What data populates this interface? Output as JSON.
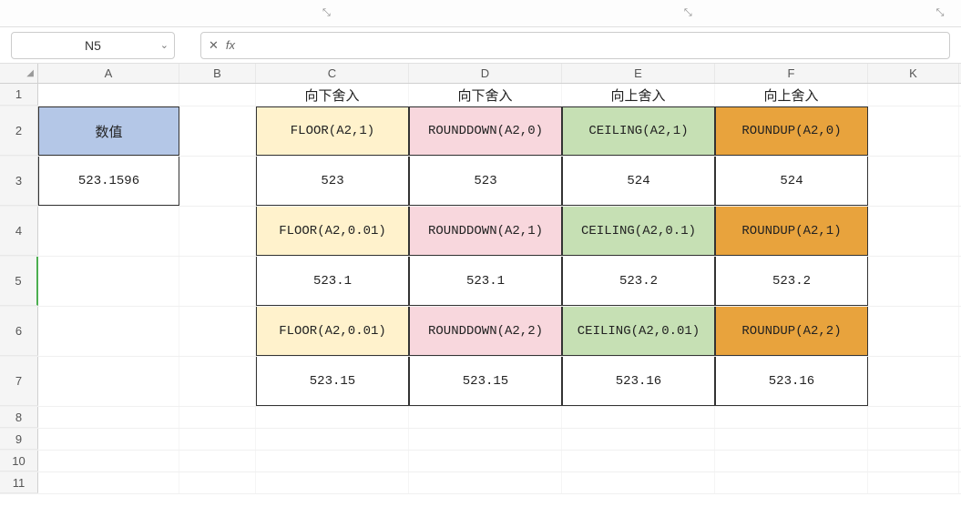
{
  "name_box": "N5",
  "formula_input": "",
  "columns": [
    "A",
    "B",
    "C",
    "D",
    "E",
    "F",
    "K"
  ],
  "rows": [
    "1",
    "2",
    "3",
    "4",
    "5",
    "6",
    "7",
    "8",
    "9",
    "10",
    "11"
  ],
  "headers_row1": {
    "C": "向下舍入",
    "D": "向下舍入",
    "E": "向上舍入",
    "F": "向上舍入"
  },
  "a_block": {
    "label": "数值",
    "value": "523.1596"
  },
  "table": {
    "r2": {
      "C": "FLOOR(A2,1)",
      "D": "ROUNDDOWN(A2,0)",
      "E": "CEILING(A2,1)",
      "F": "ROUNDUP(A2,0)"
    },
    "r3": {
      "C": "523",
      "D": "523",
      "E": "524",
      "F": "524"
    },
    "r4": {
      "C": "FLOOR(A2,0.01)",
      "D": "ROUNDDOWN(A2,1)",
      "E": "CEILING(A2,0.1)",
      "F": "ROUNDUP(A2,1)"
    },
    "r5": {
      "C": "523.1",
      "D": "523.1",
      "E": "523.2",
      "F": "523.2"
    },
    "r6": {
      "C": "FLOOR(A2,0.01)",
      "D": "ROUNDDOWN(A2,2)",
      "E": "CEILING(A2,0.01)",
      "F": "ROUNDUP(A2,2)"
    },
    "r7": {
      "C": "523.15",
      "D": "523.15",
      "E": "523.16",
      "F": "523.16"
    }
  }
}
